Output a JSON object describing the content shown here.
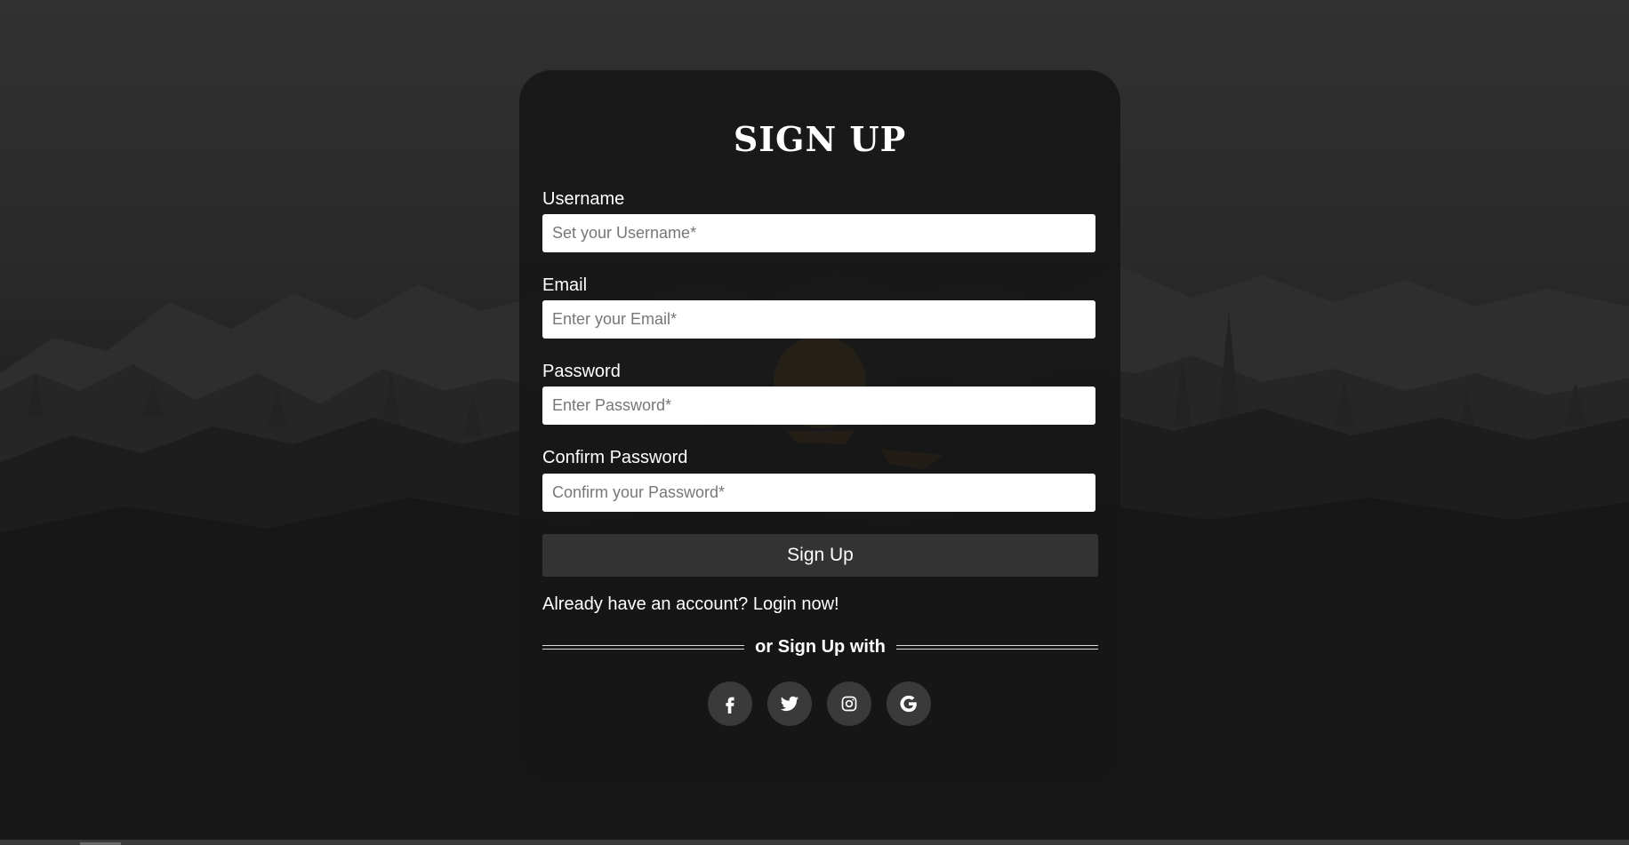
{
  "form": {
    "title": "SIGN UP",
    "fields": [
      {
        "label": "Username",
        "placeholder": "Set your Username*",
        "value": ""
      },
      {
        "label": "Email",
        "placeholder": "Enter your Email*",
        "value": ""
      },
      {
        "label": "Password",
        "placeholder": "Enter Password*",
        "value": ""
      },
      {
        "label": "Confirm Password",
        "placeholder": "Confirm your Password*",
        "value": ""
      }
    ],
    "submit_label": "Sign Up",
    "login_prompt": "Already have an account? Login now!",
    "divider_text": "or Sign Up with"
  },
  "socials": [
    {
      "name": "facebook-icon"
    },
    {
      "name": "twitter-icon"
    },
    {
      "name": "instagram-icon"
    },
    {
      "name": "google-icon"
    }
  ],
  "colors": {
    "card_bg": "#161616",
    "button_bg": "#333333",
    "social_bg": "#3a3a3a",
    "moon": "#c98a1a",
    "text": "#ffffff"
  }
}
